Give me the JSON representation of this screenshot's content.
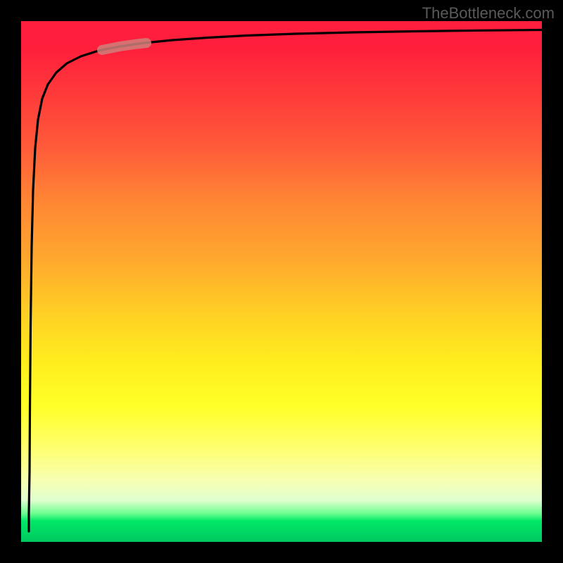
{
  "watermark_text": "TheBottleneck.com",
  "chart_data": {
    "type": "line",
    "title": "",
    "xlabel": "",
    "ylabel": "",
    "xlim": [
      0,
      100
    ],
    "ylim": [
      0,
      100
    ],
    "series": [
      {
        "name": "bottleneck-curve",
        "x": [
          1.5,
          1.6,
          1.8,
          2.0,
          2.2,
          2.5,
          3.0,
          3.5,
          4.0,
          5.0,
          6.0,
          8.0,
          10.0,
          13.0,
          16.0,
          20.0,
          25.0,
          30.0,
          40.0,
          50.0,
          60.0,
          75.0,
          90.0,
          100.0
        ],
        "y": [
          2.0,
          8.0,
          30.0,
          48.0,
          58.0,
          66.0,
          74.0,
          79.0,
          82.0,
          85.5,
          87.5,
          89.5,
          91.0,
          92.2,
          93.0,
          93.8,
          94.6,
          95.2,
          96.0,
          96.6,
          97.0,
          97.5,
          97.9,
          98.2
        ]
      }
    ],
    "highlight_segment": {
      "x_range": [
        16,
        24
      ],
      "y_range": [
        92.8,
        94.2
      ]
    },
    "background_gradient": {
      "top_color": "#ff1e3c",
      "mid_colors": [
        "#ff8434",
        "#ffef1e"
      ],
      "bottom_color": "#00c860"
    },
    "annotations": []
  }
}
